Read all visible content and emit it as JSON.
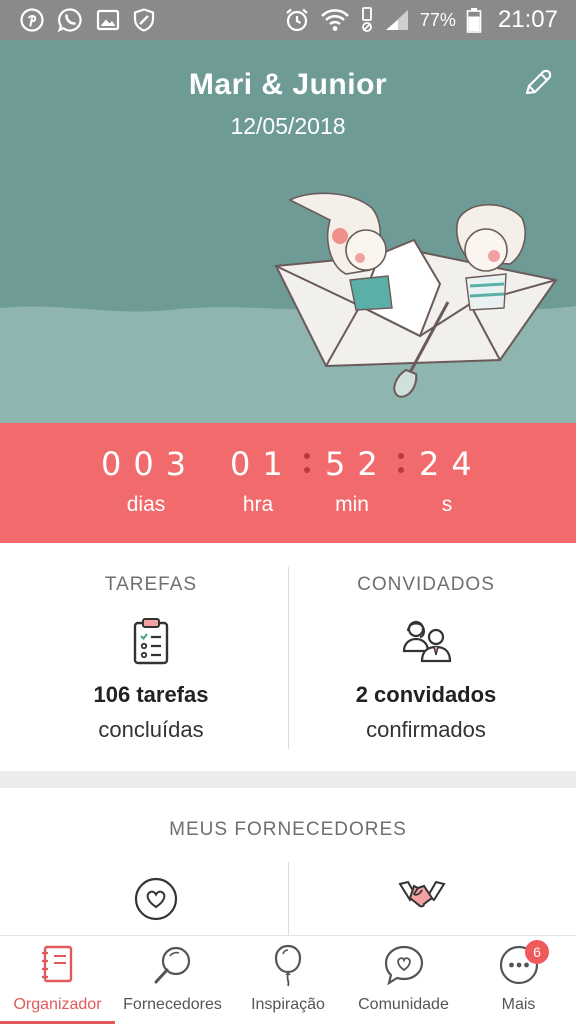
{
  "status_bar": {
    "battery": "77%",
    "time": "21:07",
    "icons_left": [
      "pinterest-icon",
      "whatsapp-icon",
      "gallery-icon",
      "shield-icon"
    ],
    "icons_right": [
      "alarm-icon",
      "wifi-icon",
      "vibrate-icon",
      "signal-icon",
      "battery-icon"
    ]
  },
  "hero": {
    "title": "Mari & Junior",
    "date": "12/05/2018",
    "edit_icon": "pencil-icon",
    "colors": {
      "background": "#6f9b96",
      "water": "#8fb5b0"
    }
  },
  "countdown": {
    "days": "003",
    "hours": "01",
    "minutes": "52",
    "seconds": "24",
    "days_label": "dias",
    "hours_label": "hra",
    "minutes_label": "min",
    "seconds_label": "s",
    "color": "#f26b6c"
  },
  "stats": {
    "tasks": {
      "heading": "TAREFAS",
      "value": "106 tarefas",
      "sub": "concluídas",
      "icon": "clipboard-checklist-icon"
    },
    "guests": {
      "heading": "CONVIDADOS",
      "value": "2 convidados",
      "sub": "confirmados",
      "icon": "couple-icon"
    }
  },
  "vendors": {
    "heading": "MEUS FORNECEDORES",
    "items": [
      {
        "icon": "heart-circle-icon"
      },
      {
        "icon": "handshake-icon"
      }
    ]
  },
  "bottom_nav": {
    "items": [
      {
        "label": "Organizador",
        "icon": "notebook-icon",
        "active": true
      },
      {
        "label": "Fornecedores",
        "icon": "magnifier-icon",
        "active": false
      },
      {
        "label": "Inspiração",
        "icon": "balloon-icon",
        "active": false
      },
      {
        "label": "Comunidade",
        "icon": "chat-heart-icon",
        "active": false
      },
      {
        "label": "Mais",
        "icon": "more-dots-icon",
        "active": false,
        "badge": "6"
      }
    ],
    "active_color": "#e2595b"
  }
}
